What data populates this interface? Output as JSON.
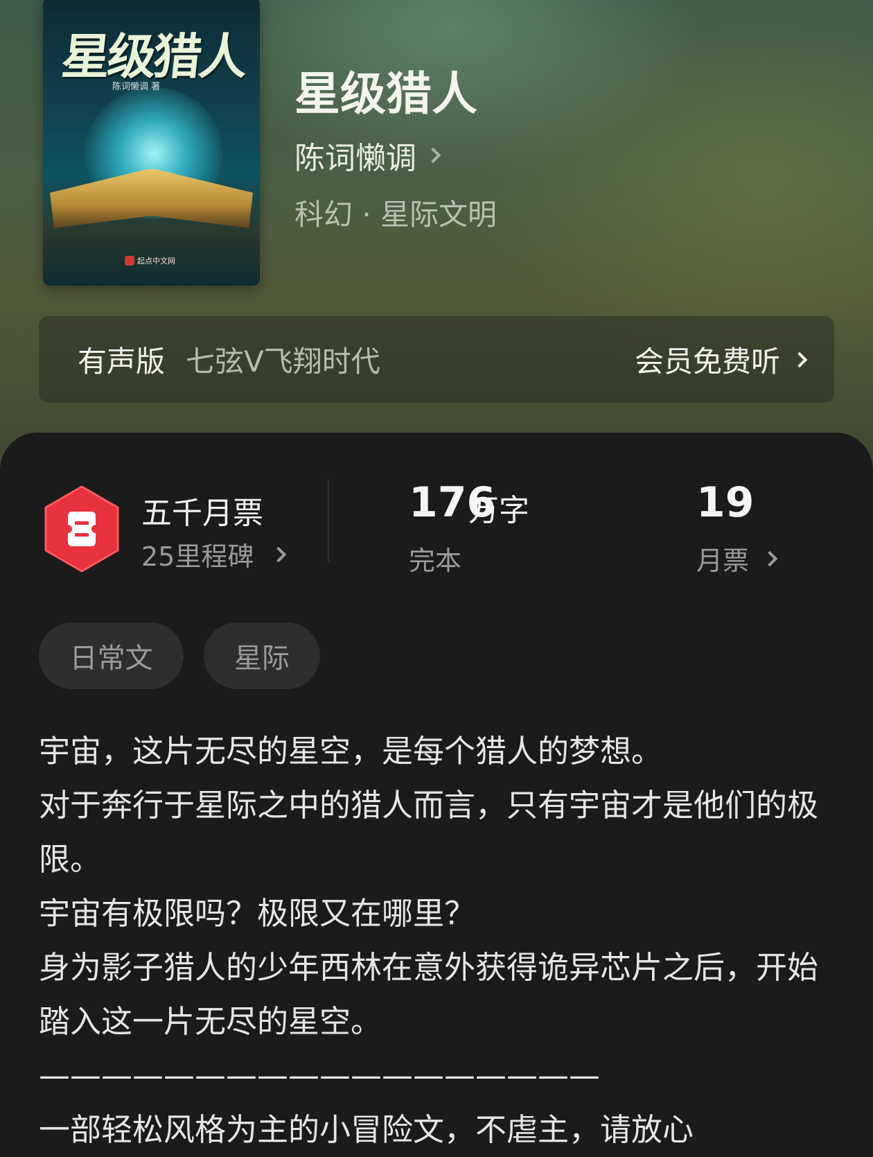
{
  "cover": {
    "title_art": "星级猎人",
    "author_art": "陈词懒调 著",
    "publisher_art": "起点中文网"
  },
  "book": {
    "title": "星级猎人",
    "author": "陈词懒调",
    "genre": "科幻 · 星际文明"
  },
  "audio": {
    "label": "有声版",
    "narrator": "七弦V飞翔时代",
    "cta": "会员免费听"
  },
  "stats": {
    "badge_title": "五千月票",
    "badge_sub": "25里程碑",
    "word_count": "176",
    "word_unit": "万字",
    "status": "完本",
    "monthly_votes": "19",
    "monthly_votes_label": "月票"
  },
  "tags": [
    "日常文",
    "星际"
  ],
  "colors": {
    "badge_red": "#e8323e",
    "content_bg": "#1b1b1b"
  },
  "synopsis": "宇宙，这片无尽的星空，是每个猎人的梦想。\n对于奔行于星际之中的猎人而言，只有宇宙才是他们的极限。\n宇宙有极限吗？极限又在哪里？\n身为影子猎人的少年西林在意外获得诡异芯片之后，开始踏入这一片无尽的星空。\n——————————————————\n一部轻松风格为主的小冒险文，不虐主，请放心"
}
